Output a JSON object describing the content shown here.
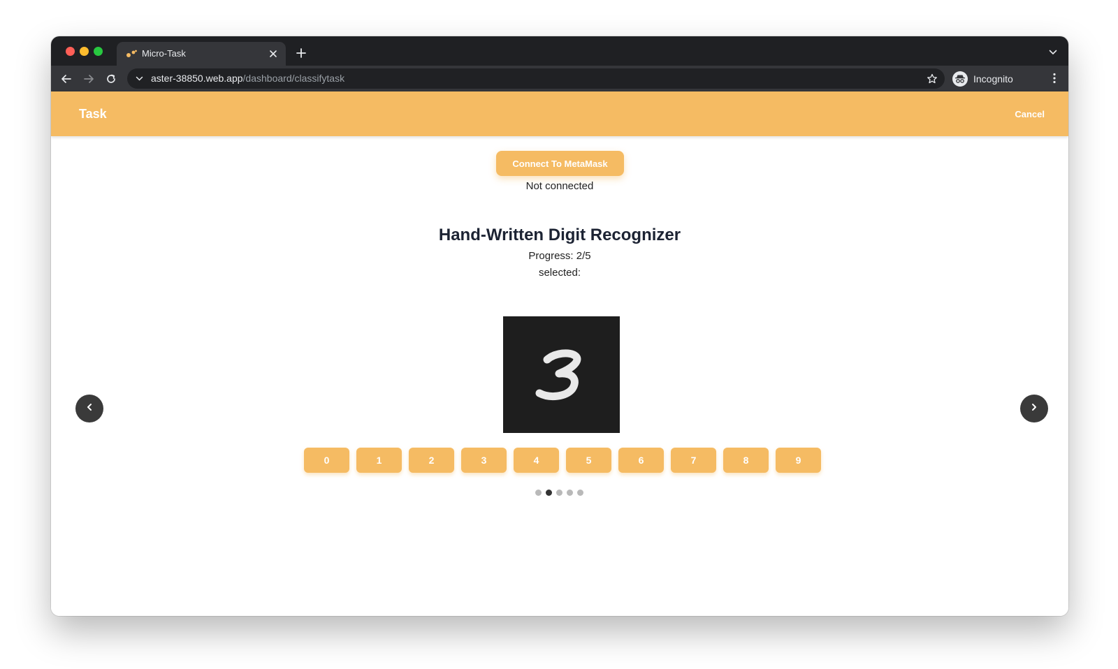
{
  "browser": {
    "tab": {
      "title": "Micro-Task"
    },
    "url": {
      "host": "aster-38850.web.app",
      "path": "/dashboard/classifytask"
    },
    "profile_label": "Incognito"
  },
  "appbar": {
    "title": "Task",
    "cancel_label": "Cancel"
  },
  "wallet": {
    "connect_label": "Connect To MetaMask",
    "status": "Not connected"
  },
  "task": {
    "title": "Hand-Written Digit Recognizer",
    "progress": "Progress: 2/5",
    "selected": "selected:",
    "image_digit": "3"
  },
  "digit_buttons": [
    "0",
    "1",
    "2",
    "3",
    "4",
    "5",
    "6",
    "7",
    "8",
    "9"
  ],
  "carousel": {
    "total": 5,
    "active_index": 1
  },
  "colors": {
    "accent": "#f5bb63",
    "titlebar": "#1f2023",
    "toolbar": "#35363a",
    "arrow": "#3a3a3a"
  },
  "icons": {
    "back": "arrow-left-icon",
    "forward": "arrow-right-icon",
    "reload": "reload-icon",
    "star": "star-icon",
    "incognito": "incognito-icon",
    "menu": "kebab-menu-icon",
    "prev": "chevron-left-icon",
    "next": "chevron-right-icon"
  }
}
